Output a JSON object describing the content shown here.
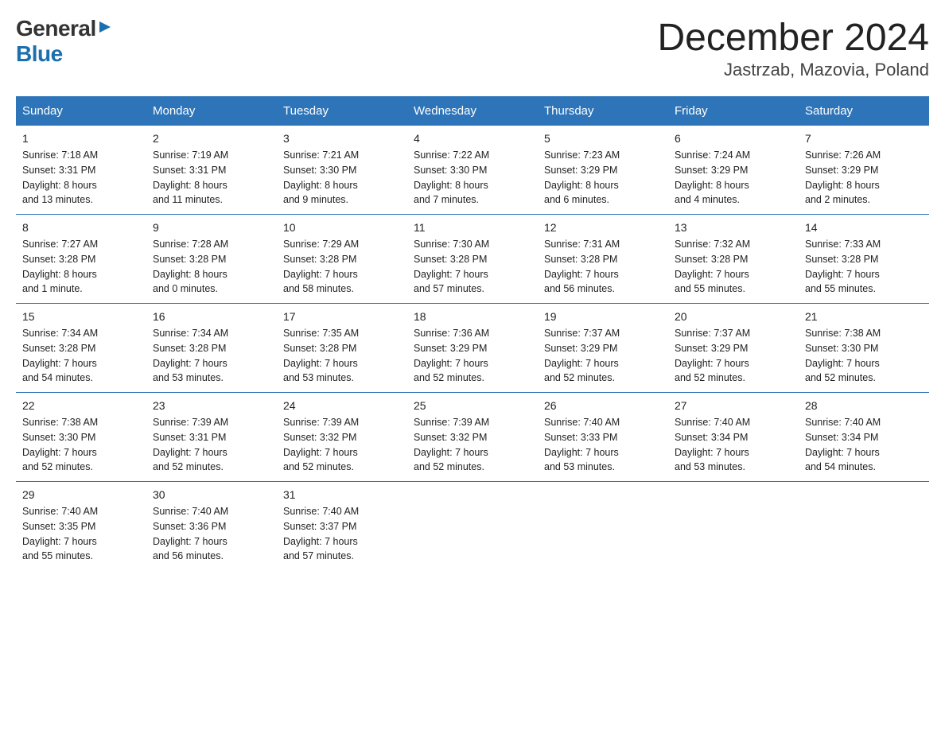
{
  "logo": {
    "general": "General",
    "blue": "Blue"
  },
  "title": "December 2024",
  "subtitle": "Jastrzab, Mazovia, Poland",
  "days_of_week": [
    "Sunday",
    "Monday",
    "Tuesday",
    "Wednesday",
    "Thursday",
    "Friday",
    "Saturday"
  ],
  "weeks": [
    [
      {
        "day": "1",
        "info": "Sunrise: 7:18 AM\nSunset: 3:31 PM\nDaylight: 8 hours\nand 13 minutes."
      },
      {
        "day": "2",
        "info": "Sunrise: 7:19 AM\nSunset: 3:31 PM\nDaylight: 8 hours\nand 11 minutes."
      },
      {
        "day": "3",
        "info": "Sunrise: 7:21 AM\nSunset: 3:30 PM\nDaylight: 8 hours\nand 9 minutes."
      },
      {
        "day": "4",
        "info": "Sunrise: 7:22 AM\nSunset: 3:30 PM\nDaylight: 8 hours\nand 7 minutes."
      },
      {
        "day": "5",
        "info": "Sunrise: 7:23 AM\nSunset: 3:29 PM\nDaylight: 8 hours\nand 6 minutes."
      },
      {
        "day": "6",
        "info": "Sunrise: 7:24 AM\nSunset: 3:29 PM\nDaylight: 8 hours\nand 4 minutes."
      },
      {
        "day": "7",
        "info": "Sunrise: 7:26 AM\nSunset: 3:29 PM\nDaylight: 8 hours\nand 2 minutes."
      }
    ],
    [
      {
        "day": "8",
        "info": "Sunrise: 7:27 AM\nSunset: 3:28 PM\nDaylight: 8 hours\nand 1 minute."
      },
      {
        "day": "9",
        "info": "Sunrise: 7:28 AM\nSunset: 3:28 PM\nDaylight: 8 hours\nand 0 minutes."
      },
      {
        "day": "10",
        "info": "Sunrise: 7:29 AM\nSunset: 3:28 PM\nDaylight: 7 hours\nand 58 minutes."
      },
      {
        "day": "11",
        "info": "Sunrise: 7:30 AM\nSunset: 3:28 PM\nDaylight: 7 hours\nand 57 minutes."
      },
      {
        "day": "12",
        "info": "Sunrise: 7:31 AM\nSunset: 3:28 PM\nDaylight: 7 hours\nand 56 minutes."
      },
      {
        "day": "13",
        "info": "Sunrise: 7:32 AM\nSunset: 3:28 PM\nDaylight: 7 hours\nand 55 minutes."
      },
      {
        "day": "14",
        "info": "Sunrise: 7:33 AM\nSunset: 3:28 PM\nDaylight: 7 hours\nand 55 minutes."
      }
    ],
    [
      {
        "day": "15",
        "info": "Sunrise: 7:34 AM\nSunset: 3:28 PM\nDaylight: 7 hours\nand 54 minutes."
      },
      {
        "day": "16",
        "info": "Sunrise: 7:34 AM\nSunset: 3:28 PM\nDaylight: 7 hours\nand 53 minutes."
      },
      {
        "day": "17",
        "info": "Sunrise: 7:35 AM\nSunset: 3:28 PM\nDaylight: 7 hours\nand 53 minutes."
      },
      {
        "day": "18",
        "info": "Sunrise: 7:36 AM\nSunset: 3:29 PM\nDaylight: 7 hours\nand 52 minutes."
      },
      {
        "day": "19",
        "info": "Sunrise: 7:37 AM\nSunset: 3:29 PM\nDaylight: 7 hours\nand 52 minutes."
      },
      {
        "day": "20",
        "info": "Sunrise: 7:37 AM\nSunset: 3:29 PM\nDaylight: 7 hours\nand 52 minutes."
      },
      {
        "day": "21",
        "info": "Sunrise: 7:38 AM\nSunset: 3:30 PM\nDaylight: 7 hours\nand 52 minutes."
      }
    ],
    [
      {
        "day": "22",
        "info": "Sunrise: 7:38 AM\nSunset: 3:30 PM\nDaylight: 7 hours\nand 52 minutes."
      },
      {
        "day": "23",
        "info": "Sunrise: 7:39 AM\nSunset: 3:31 PM\nDaylight: 7 hours\nand 52 minutes."
      },
      {
        "day": "24",
        "info": "Sunrise: 7:39 AM\nSunset: 3:32 PM\nDaylight: 7 hours\nand 52 minutes."
      },
      {
        "day": "25",
        "info": "Sunrise: 7:39 AM\nSunset: 3:32 PM\nDaylight: 7 hours\nand 52 minutes."
      },
      {
        "day": "26",
        "info": "Sunrise: 7:40 AM\nSunset: 3:33 PM\nDaylight: 7 hours\nand 53 minutes."
      },
      {
        "day": "27",
        "info": "Sunrise: 7:40 AM\nSunset: 3:34 PM\nDaylight: 7 hours\nand 53 minutes."
      },
      {
        "day": "28",
        "info": "Sunrise: 7:40 AM\nSunset: 3:34 PM\nDaylight: 7 hours\nand 54 minutes."
      }
    ],
    [
      {
        "day": "29",
        "info": "Sunrise: 7:40 AM\nSunset: 3:35 PM\nDaylight: 7 hours\nand 55 minutes."
      },
      {
        "day": "30",
        "info": "Sunrise: 7:40 AM\nSunset: 3:36 PM\nDaylight: 7 hours\nand 56 minutes."
      },
      {
        "day": "31",
        "info": "Sunrise: 7:40 AM\nSunset: 3:37 PM\nDaylight: 7 hours\nand 57 minutes."
      },
      {
        "day": "",
        "info": ""
      },
      {
        "day": "",
        "info": ""
      },
      {
        "day": "",
        "info": ""
      },
      {
        "day": "",
        "info": ""
      }
    ]
  ]
}
